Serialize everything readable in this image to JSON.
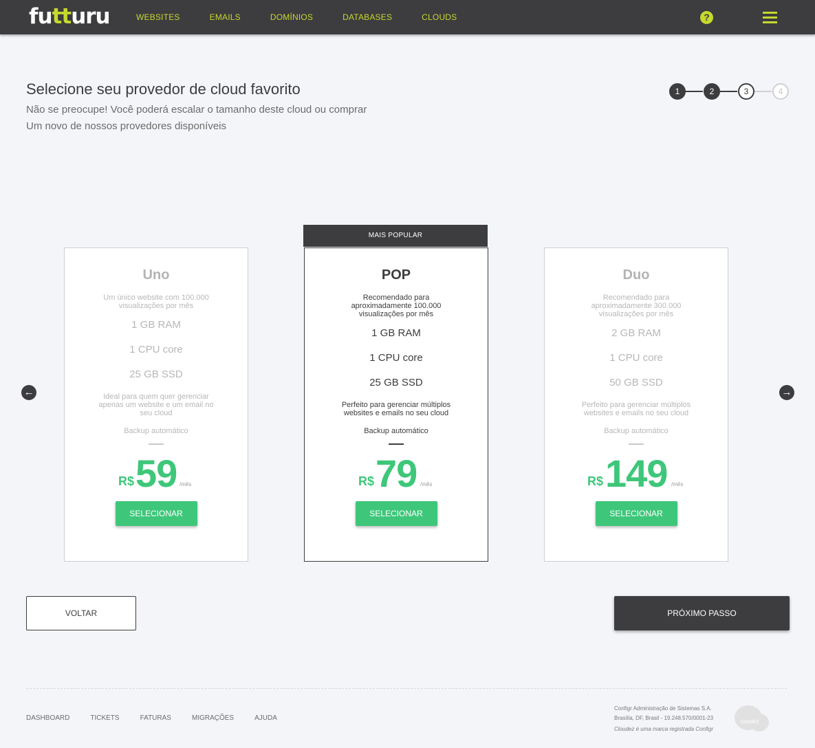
{
  "header": {
    "logo": {
      "pre": "fu",
      "accent": "tt",
      "post": "uru"
    },
    "nav": [
      "WEBSITES",
      "EMAILS",
      "DOMÍNIOS",
      "DATABASES",
      "CLOUDS"
    ],
    "help_glyph": "?",
    "help_icon": "question-circle-icon",
    "menu_icon": "hamburger-menu-icon"
  },
  "page": {
    "title": "Selecione seu provedor de cloud favorito",
    "subtitle_line1": "Não se preocupe! Você poderá escalar o tamanho deste cloud ou comprar",
    "subtitle_line2": "Um novo de nossos provedores disponíveis"
  },
  "stepper": {
    "steps": [
      "1",
      "2",
      "3",
      "4"
    ],
    "current": 3
  },
  "plans": {
    "popular_label": "MAIS POPULAR",
    "select_label": "SELECIONAR",
    "currency": "R$",
    "period": "/mês",
    "uno": {
      "name": "Uno",
      "desc": "Um único website com 100.000 visualizações por mês",
      "ram": "1 GB RAM",
      "cpu": "1 CPU core",
      "ssd": "25 GB SSD",
      "extra": "Ideal para quem quer gerenciar apenas um website e um email no seu cloud",
      "backup": "Backup automático",
      "price": "59"
    },
    "pop": {
      "name": "POP",
      "desc": "Recomendado para aproximadamente 100.000 visualizações por mês",
      "ram": "1 GB RAM",
      "cpu": "1 CPU core",
      "ssd": "25 GB SSD",
      "extra": "Perfeito para gerenciar múltiplos websites e emails no seu cloud",
      "backup": "Backup automático",
      "price": "79"
    },
    "duo": {
      "name": "Duo",
      "desc": "Recomendado para aproximadamente 300.000 visualizações por mês",
      "ram": "2 GB RAM",
      "cpu": "1 CPU core",
      "ssd": "50 GB SSD",
      "extra": "Perfeito para gerenciar múltiplos websites e emails no seu cloud",
      "backup": "Backup automático",
      "price": "149"
    }
  },
  "carousel": {
    "prev_icon": "arrow-left-circle-icon",
    "next_icon": "arrow-right-circle-icon",
    "prev_glyph": "←",
    "next_glyph": "→"
  },
  "actions": {
    "back": "VOLTAR",
    "next": "PRÓXIMO PASSO"
  },
  "footer": {
    "links": [
      "DASHBOARD",
      "TICKETS",
      "FATURAS",
      "MIGRAÇÕES",
      "AJUDA"
    ],
    "company_line1": "Configr Administração de Sistemas S.A.",
    "company_line2": "Brasília, DF, Brasil - 19.248.570/0001-23",
    "company_line3": "Cloudez é uma marca registrada Configr",
    "cloud_logo_text": "cloudez"
  },
  "colors": {
    "accent": "#c6d92e",
    "dark": "#3d3c3e",
    "price_green": "#3ec77a",
    "background": "#f4f5f9"
  }
}
